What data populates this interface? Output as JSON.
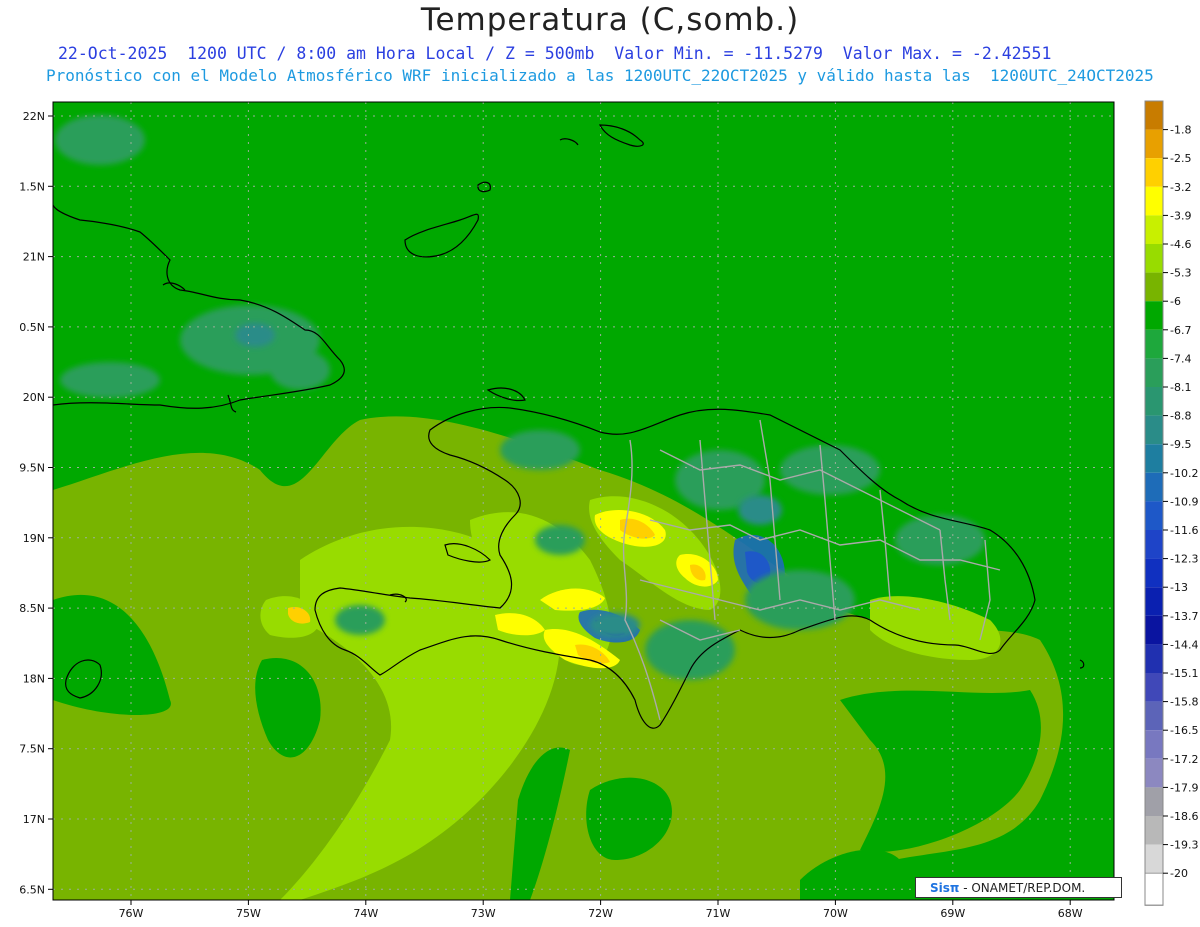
{
  "header": {
    "title": "Temperatura (C,somb.)",
    "line1": "22-Oct-2025  1200 UTC / 8:00 am Hora Local / Z = 500mb  Valor Min. = -11.5279  Valor Max. = -2.42551",
    "line2": "Pronóstico con el Modelo Atmosférico WRF inicializado a las 1200UTC_22OCT2025 y válido hasta las  1200UTC_24OCT2025"
  },
  "axes": {
    "lat_labels": [
      "22N",
      "1.5N",
      "21N",
      "0.5N",
      "20N",
      "9.5N",
      "19N",
      "8.5N",
      "18N",
      "7.5N",
      "17N",
      "6.5N"
    ],
    "lon_labels": [
      "76W",
      "75W",
      "74W",
      "73W",
      "72W",
      "71W",
      "70W",
      "69W",
      "68W"
    ]
  },
  "colorbar": {
    "labels": [
      "-1.8",
      "-2.5",
      "-3.2",
      "-3.9",
      "-4.6",
      "-5.3",
      "-6",
      "-6.7",
      "-7.4",
      "-8.1",
      "-8.8",
      "-9.5",
      "-10.2",
      "-10.9",
      "-11.6",
      "-12.3",
      "-13",
      "-13.7",
      "-14.4",
      "-15.1",
      "-15.8",
      "-16.5",
      "-17.2",
      "-17.9",
      "-18.6",
      "-19.3",
      "-20"
    ],
    "colors": [
      "#c87c00",
      "#e8a000",
      "#ffd000",
      "#ffff00",
      "#c8f000",
      "#98dc00",
      "#78b400",
      "#00a800",
      "#1ea83c",
      "#2a9e5a",
      "#2a9670",
      "#2a8c88",
      "#1e7ea0",
      "#1e6cb8",
      "#1e58c8",
      "#1e44c8",
      "#1030c0",
      "#0a20b0",
      "#0a14a0",
      "#2030b0",
      "#4048b8",
      "#5c64b8",
      "#7878c0",
      "#8c88c0",
      "#a0a0a8",
      "#b8b8b8",
      "#d8d8d8"
    ]
  },
  "credit": {
    "brand": "Sisπ",
    "text": " - ONAMET/REP.DOM."
  }
}
